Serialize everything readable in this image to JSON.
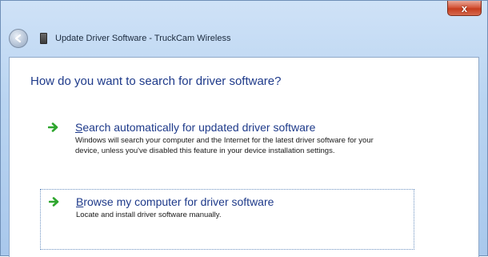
{
  "window": {
    "title": "Update Driver Software - TruckCam Wireless",
    "close_label": "x"
  },
  "heading": "How do you want to search for driver software?",
  "options": [
    {
      "accelerator": "S",
      "title_rest": "earch automatically for updated driver software",
      "description": "Windows will search your computer and the Internet for the latest driver software for your device, unless you've disabled this feature in your device installation settings.",
      "icon": "green-arrow-icon"
    },
    {
      "accelerator": "B",
      "title_rest": "rowse my computer for driver software",
      "description": "Locate and install driver software manually.",
      "icon": "green-arrow-icon"
    }
  ],
  "colors": {
    "heading": "#1e3a8a",
    "close_button": "#d5583c",
    "arrow": "#2ea62e"
  }
}
